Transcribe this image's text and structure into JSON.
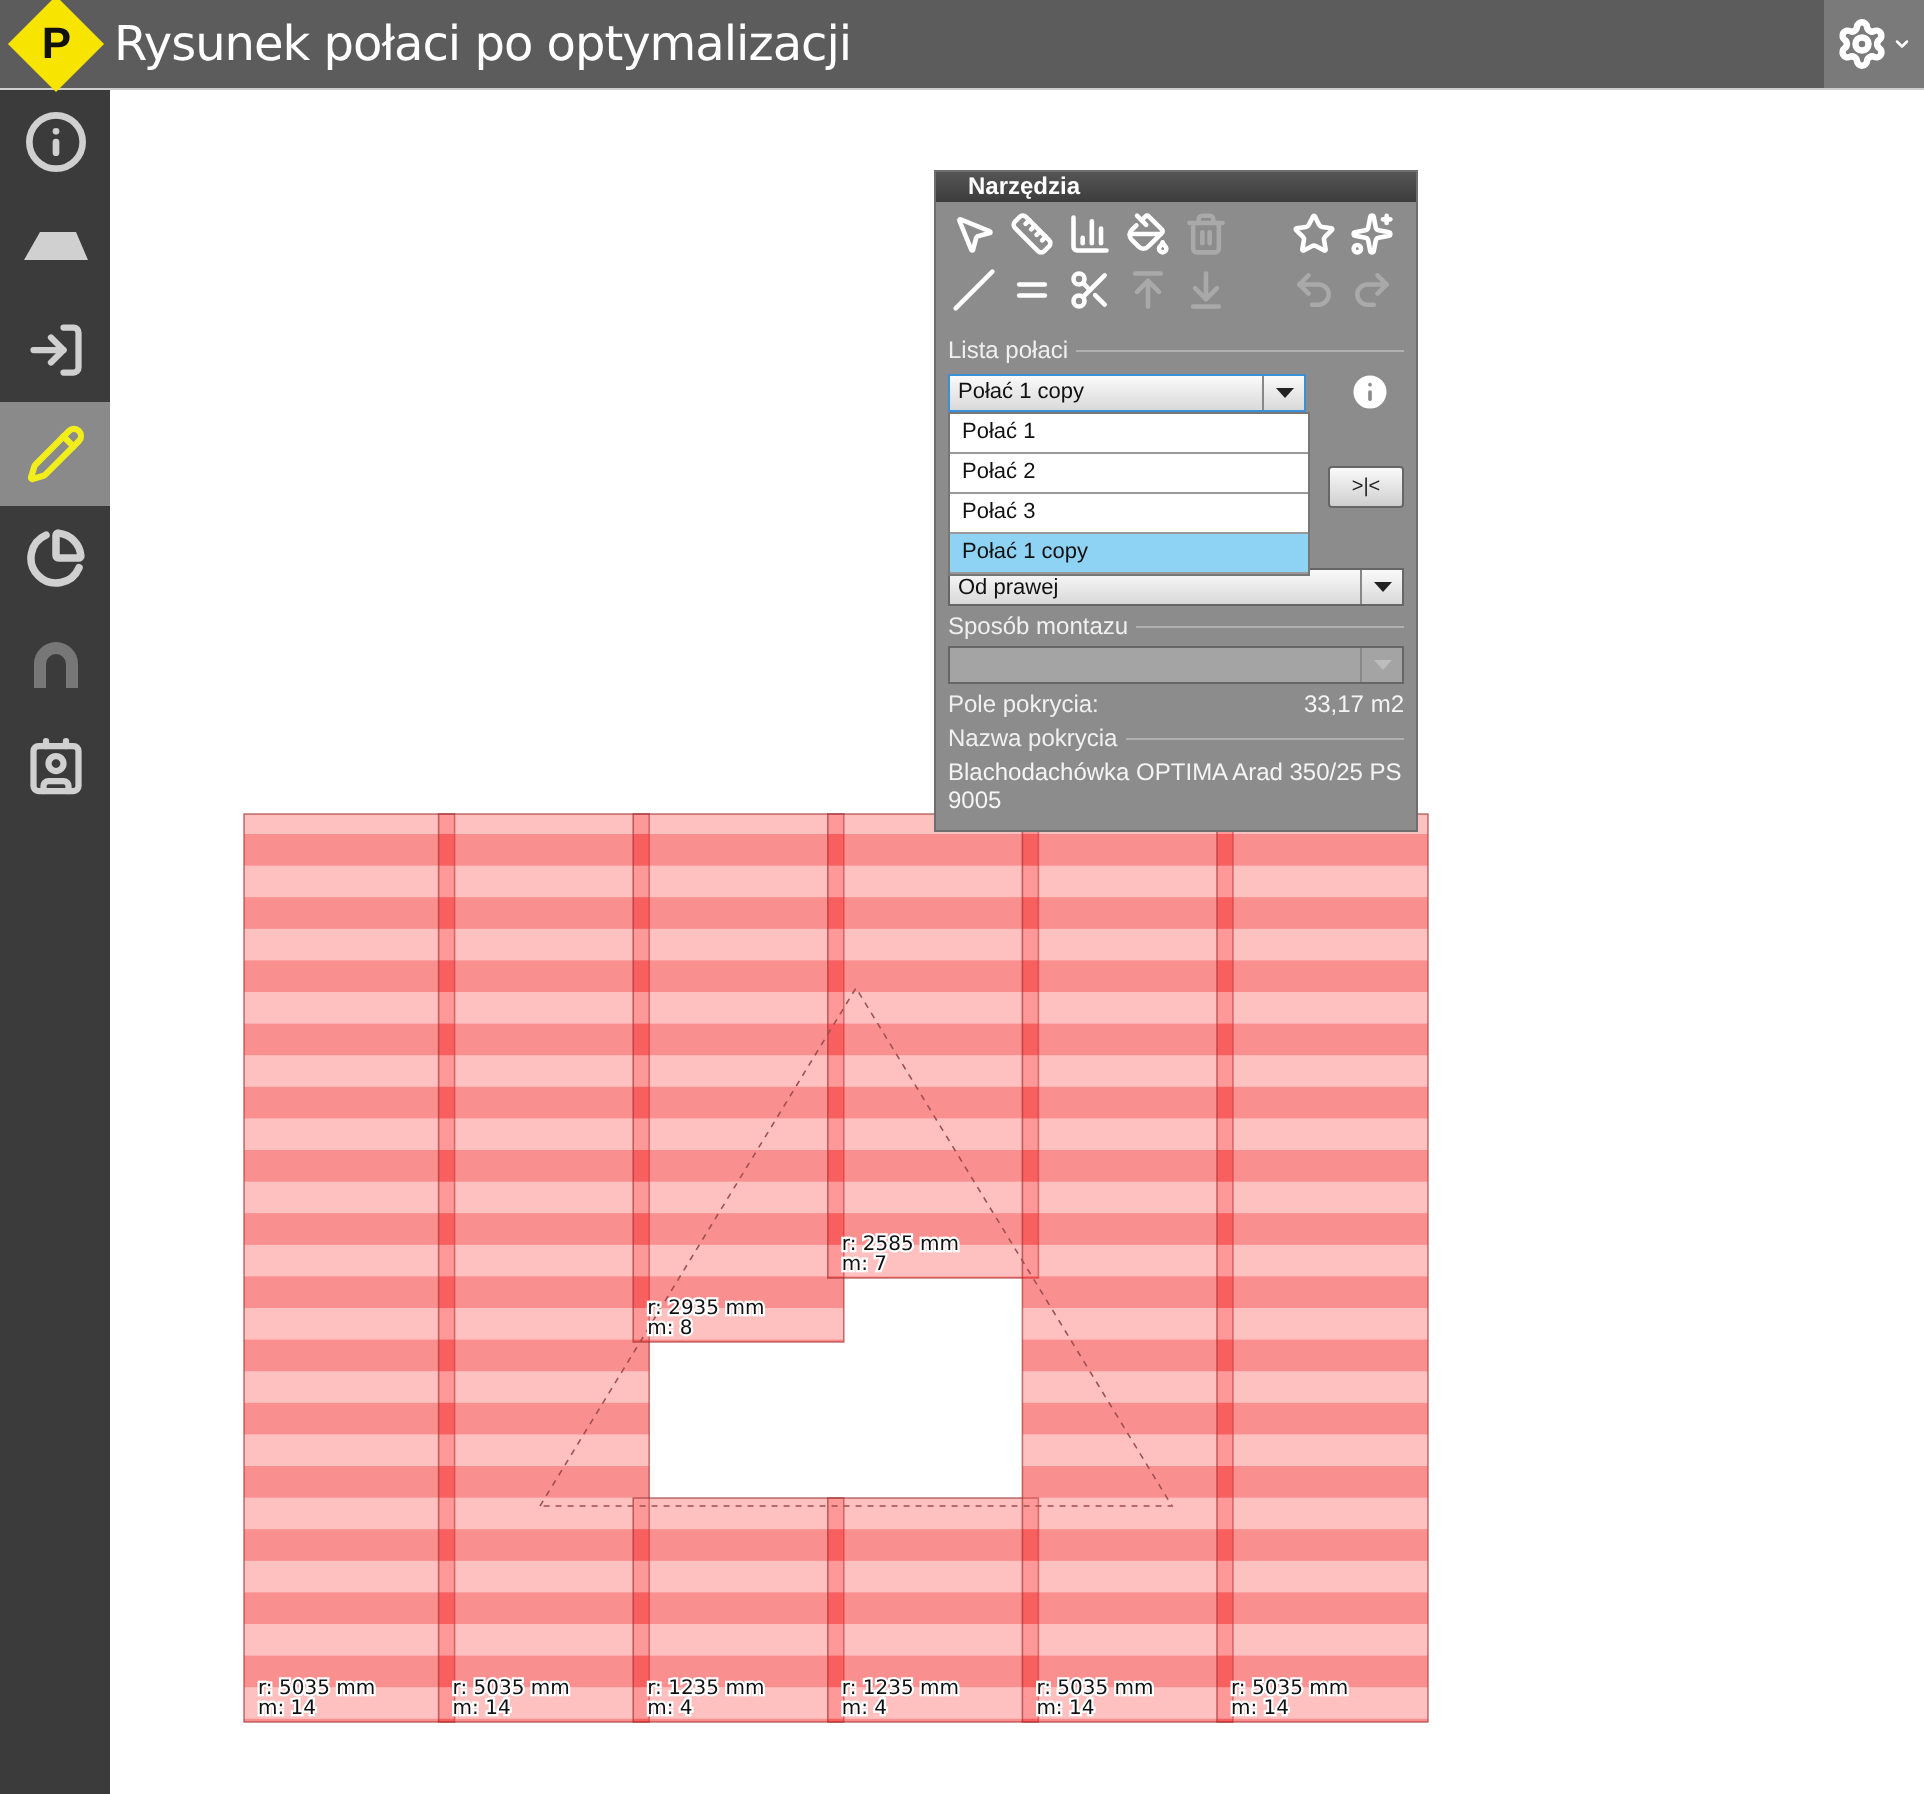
{
  "header": {
    "logo": "P",
    "title": "Rysunek połaci po optymalizacji"
  },
  "nav": [
    {
      "selected": false
    },
    {
      "selected": false
    },
    {
      "selected": false
    },
    {
      "selected": true
    },
    {
      "selected": false
    },
    {
      "selected": false
    },
    {
      "selected": false
    }
  ],
  "tools_panel": {
    "title": "Narzędzia",
    "tools": [
      {
        "disabled": false
      },
      {
        "disabled": false
      },
      {
        "disabled": false
      },
      {
        "disabled": false
      },
      {
        "disabled": true
      },
      {
        "disabled": false
      },
      {
        "disabled": false
      },
      {
        "disabled": false
      },
      {
        "disabled": false
      },
      {
        "disabled": false
      },
      {
        "disabled": true
      },
      {
        "disabled": true
      },
      {
        "disabled": true
      },
      {
        "disabled": true
      }
    ],
    "roof_list": {
      "label": "Lista połaci",
      "value": "Połać 1 copy",
      "expanded": true,
      "options": [
        {
          "label": "Połać 1",
          "selected": false
        },
        {
          "label": "Połać 2",
          "selected": false
        },
        {
          "label": "Połać 3",
          "selected": false
        },
        {
          "label": "Połać 1 copy",
          "selected": true
        }
      ]
    },
    "align_button": ">|<",
    "direction": {
      "value": "Od prawej"
    },
    "mounting": {
      "label": "Sposób montazu",
      "disabled": true
    },
    "area": {
      "label": "Pole pokrycia:",
      "value": "33,17 m2"
    },
    "covering": {
      "label": "Nazwa pokrycia",
      "value": "Blachodachówka OPTIMA Arad 350/25 PS 9005"
    }
  },
  "sheets": [
    {
      "length": "r: 5035 mm",
      "count": "m: 14"
    },
    {
      "length": "r: 5035 mm",
      "count": "m: 14"
    },
    {
      "length": "r: 2935 mm",
      "count": "m: 8"
    },
    {
      "length": "r: 1235 mm",
      "count": "m: 4"
    },
    {
      "length": "r: 2585 mm",
      "count": "m: 7"
    },
    {
      "length": "r: 1235 mm",
      "count": "m: 4"
    },
    {
      "length": "r: 5035 mm",
      "count": "m: 14"
    },
    {
      "length": "r: 5035 mm",
      "count": "m: 14"
    }
  ]
}
